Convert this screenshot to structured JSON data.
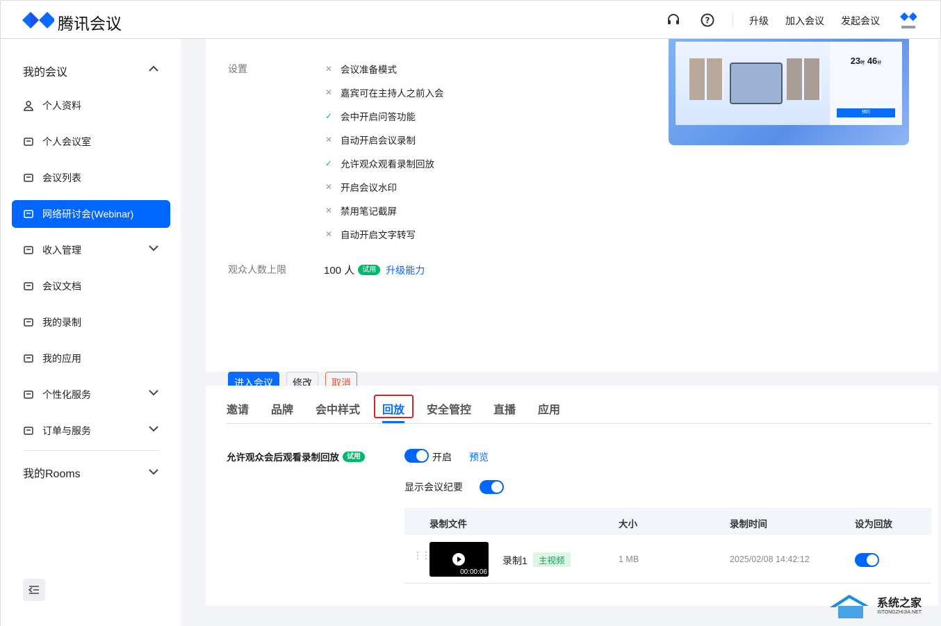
{
  "header": {
    "app_name": "腾讯会议",
    "links": [
      "升级",
      "加入会议",
      "发起会议"
    ],
    "icons": [
      "headset-icon",
      "help-icon"
    ]
  },
  "sidebar": {
    "group_title": "我的会议",
    "items": [
      {
        "label": "个人资料",
        "icon": "user-icon"
      },
      {
        "label": "个人会议室",
        "icon": "room-icon"
      },
      {
        "label": "会议列表",
        "icon": "list-icon"
      },
      {
        "label": "网络研讨会(Webinar)",
        "icon": "webinar-icon",
        "active": true
      },
      {
        "label": "收入管理",
        "icon": "wallet-icon",
        "expandable": true
      },
      {
        "label": "会议文档",
        "icon": "doc-icon"
      },
      {
        "label": "我的录制",
        "icon": "video-icon"
      },
      {
        "label": "我的应用",
        "icon": "layers-icon"
      },
      {
        "label": "个性化服务",
        "icon": "service-icon",
        "expandable": true
      },
      {
        "label": "订单与服务",
        "icon": "clipboard-icon",
        "expandable": true
      }
    ],
    "rooms_title": "我的Rooms"
  },
  "settings": {
    "label": "设置",
    "items": [
      {
        "text": "会议准备模式",
        "enabled": false
      },
      {
        "text": "嘉宾可在主持人之前入会",
        "enabled": false
      },
      {
        "text": "会中开启问答功能",
        "enabled": true
      },
      {
        "text": "自动开启会议录制",
        "enabled": false
      },
      {
        "text": "允许观众观看录制回放",
        "enabled": true
      },
      {
        "text": "开启会议水印",
        "enabled": false
      },
      {
        "text": "禁用笔记截屏",
        "enabled": false
      },
      {
        "text": "自动开启文字转写",
        "enabled": false
      }
    ],
    "audience_label": "观众人数上限",
    "audience_value": "100 人",
    "trial_badge": "试用",
    "upgrade_link": "升级能力"
  },
  "preview": {
    "countdown_h": "23",
    "countdown_m": "46",
    "h_unit": "时",
    "m_unit": "分",
    "button": "预约"
  },
  "actions": {
    "enter": "进入会议",
    "edit": "修改",
    "cancel": "取消"
  },
  "tabs": [
    "邀请",
    "品牌",
    "会中样式",
    "回放",
    "安全管控",
    "直播",
    "应用"
  ],
  "active_tab": "回放",
  "playback": {
    "allow_label": "允许观众会后观看录制回放",
    "trial_badge": "试用",
    "toggle_label": "开启",
    "preview_link": "预览",
    "summary_label": "显示会议纪要",
    "table": {
      "headers": [
        "录制文件",
        "大小",
        "录制时间",
        "设为回放"
      ],
      "rows": [
        {
          "name": "录制1",
          "tag": "主视频",
          "duration": "00:00:06",
          "size": "1 MB",
          "time": "2025/02/08 14:42:12",
          "set_playback": true
        }
      ]
    }
  },
  "watermark": {
    "title": "系统之家",
    "url": "XITONGZHIJIA.NET"
  }
}
